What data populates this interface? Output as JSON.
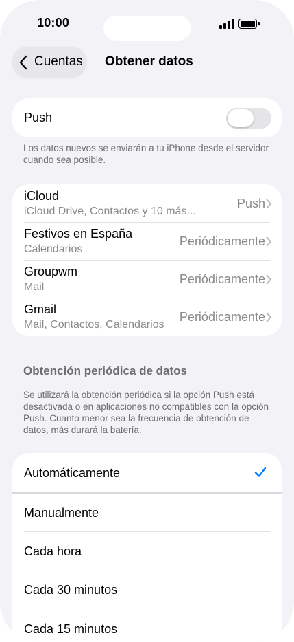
{
  "status_bar": {
    "time": "10:00"
  },
  "nav": {
    "back_label": "Cuentas",
    "title": "Obtener datos"
  },
  "push": {
    "label": "Push",
    "enabled": false,
    "footnote": "Los datos nuevos se enviarán a tu iPhone desde el servidor cuando sea posible."
  },
  "accounts": [
    {
      "name": "iCloud",
      "detail": "iCloud Drive, Contactos y 10 más...",
      "value": "Push"
    },
    {
      "name": "Festivos en España",
      "detail": "Calendarios",
      "value": "Periódicamente"
    },
    {
      "name": "Groupwm",
      "detail": "Mail",
      "value": "Periódicamente"
    },
    {
      "name": "Gmail",
      "detail": "Mail, Contactos, Calendarios",
      "value": "Periódicamente"
    }
  ],
  "fetch": {
    "header": "Obtención periódica de datos",
    "footnote": "Se utilizará la obtención periódica si la opción Push está desactivada o en aplicaciones no compatibles con la opción Push. Cuanto menor sea la frecuencia de obtención de datos, más durará la batería.",
    "options": [
      {
        "label": "Automáticamente",
        "selected": true
      },
      {
        "label": "Manualmente",
        "selected": false
      },
      {
        "label": "Cada hora",
        "selected": false
      },
      {
        "label": "Cada 30 minutos",
        "selected": false
      },
      {
        "label": "Cada 15 minutos",
        "selected": false
      }
    ]
  },
  "colors": {
    "accent": "#007aff",
    "background": "#f2f2f7",
    "secondary_text": "#8a8a8e"
  },
  "icons": [
    "chevron-left-icon",
    "chevron-right-icon",
    "checkmark-icon",
    "signal-icon",
    "battery-icon"
  ]
}
